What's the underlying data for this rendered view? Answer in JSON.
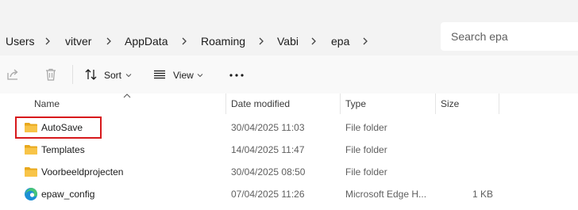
{
  "breadcrumb": {
    "items": [
      "Users",
      "vitver",
      "AppData",
      "Roaming",
      "Vabi",
      "epa"
    ]
  },
  "search": {
    "placeholder": "Search epa"
  },
  "toolbar": {
    "sort_label": "Sort",
    "view_label": "View",
    "more_label": "..."
  },
  "columns": {
    "name": "Name",
    "date_modified": "Date modified",
    "type": "Type",
    "size": "Size"
  },
  "files": [
    {
      "name": "AutoSave",
      "date": "30/04/2025 11:03",
      "type": "File folder",
      "size": "",
      "icon": "folder-icon"
    },
    {
      "name": "Templates",
      "date": "14/04/2025 11:47",
      "type": "File folder",
      "size": "",
      "icon": "folder-icon"
    },
    {
      "name": "Voorbeeldprojecten",
      "date": "30/04/2025 08:50",
      "type": "File folder",
      "size": "",
      "icon": "folder-icon"
    },
    {
      "name": "epaw_config",
      "date": "07/04/2025 11:26",
      "type": "Microsoft Edge H...",
      "size": "1 KB",
      "icon": "edge-icon"
    }
  ],
  "colors": {
    "highlight": "#d7191c",
    "folder": "#f8c448",
    "toolbar_bg": "#f9f9f9",
    "address_bg": "#f3f3f3"
  }
}
